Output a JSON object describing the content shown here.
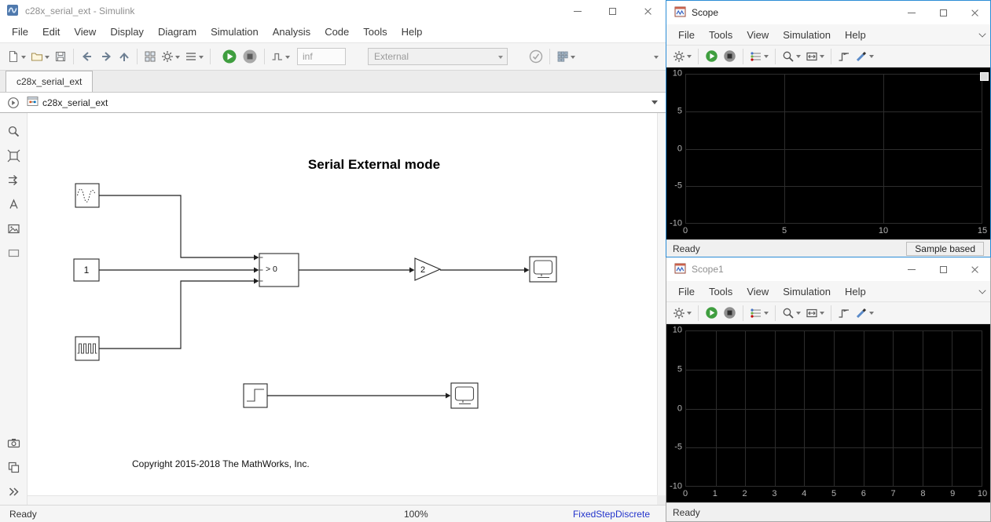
{
  "simulink": {
    "window_title": "c28x_serial_ext - Simulink",
    "menu": [
      "File",
      "Edit",
      "View",
      "Display",
      "Diagram",
      "Simulation",
      "Analysis",
      "Code",
      "Tools",
      "Help"
    ],
    "toolbar": {
      "sim_stop_time": "inf",
      "mode": "External"
    },
    "tab_label": "c28x_serial_ext",
    "breadcrumb": "c28x_serial_ext",
    "diagram": {
      "title": "Serial External mode",
      "constant_value": "1",
      "switch_criteria": "> 0",
      "gain_value": "2",
      "copyright": "Copyright 2015-2018 The MathWorks, Inc."
    },
    "status": {
      "state": "Ready",
      "zoom": "100%",
      "solver": "FixedStepDiscrete"
    }
  },
  "scope": {
    "window_title": "Scope",
    "menu": [
      "File",
      "Tools",
      "View",
      "Simulation",
      "Help"
    ],
    "y_ticks": [
      "10",
      "5",
      "0",
      "-5",
      "-10"
    ],
    "x_ticks": [
      "0",
      "5",
      "10",
      "15"
    ],
    "status": {
      "state": "Ready",
      "mode": "Sample based"
    }
  },
  "scope1": {
    "window_title": "Scope1",
    "menu": [
      "File",
      "Tools",
      "View",
      "Simulation",
      "Help"
    ],
    "y_ticks": [
      "10",
      "5",
      "0",
      "-5",
      "-10"
    ],
    "x_ticks": [
      "0",
      "1",
      "2",
      "3",
      "4",
      "5",
      "6",
      "7",
      "8",
      "9",
      "10"
    ],
    "status": {
      "state": "Ready"
    }
  }
}
